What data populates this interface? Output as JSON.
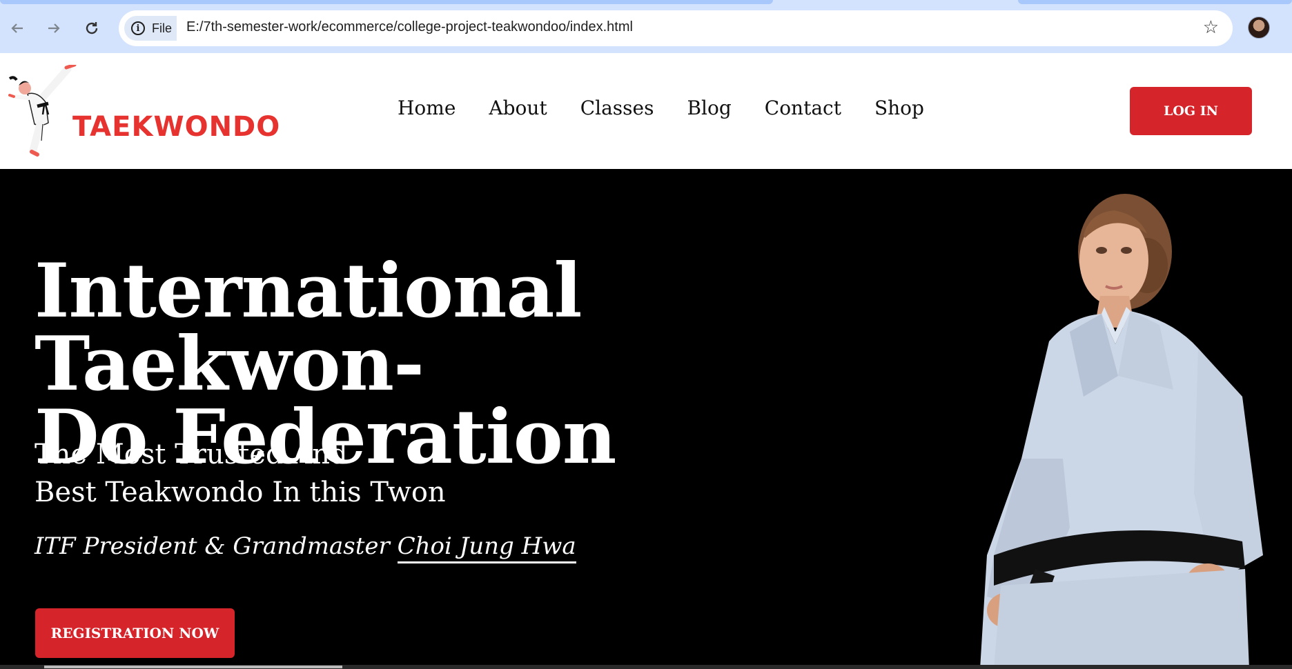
{
  "browser": {
    "back_icon": "arrow-left-icon",
    "forward_icon": "arrow-right-icon",
    "reload_icon": "reload-icon",
    "site_info_icon": "info-icon",
    "site_info_label": "File",
    "url": "E:/7th-semester-work/ecommerce/college-project-teakwondoo/index.html",
    "bookmark_icon": "star-icon",
    "profile_icon": "profile-avatar"
  },
  "header": {
    "logo_text": "TAEKWONDO",
    "nav": [
      "Home",
      "About",
      "Classes",
      "Blog",
      "Contact",
      "Shop"
    ],
    "login_label": "LOG IN"
  },
  "hero": {
    "title_line1": "International Taekwon-",
    "title_line2": "Do Federation",
    "subtitle_line1": "The Most Trusted And",
    "subtitle_line2": "Best Teakwondo In this Twon",
    "quote_prefix": "ITF President & Grandmaster ",
    "quote_name": "Choi Jung Hwa",
    "cta_label": "REGISTRATION NOW"
  },
  "colors": {
    "accent": "#d5242a",
    "logo_red": "#e7332f",
    "hero_bg": "#000000",
    "chrome_bg": "#d3e3fd"
  }
}
